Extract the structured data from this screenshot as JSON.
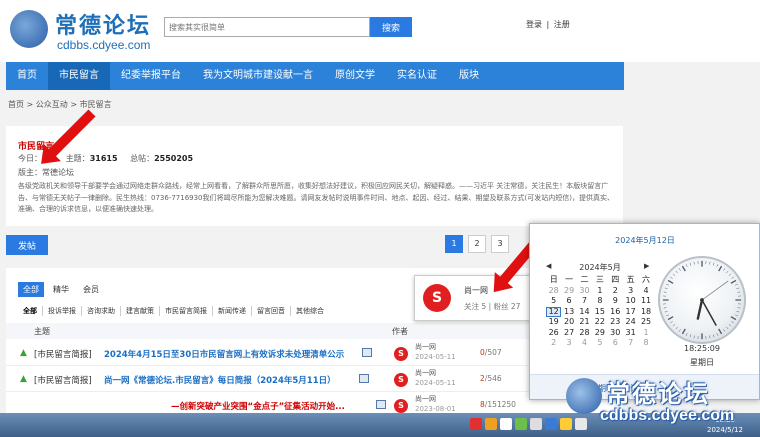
{
  "site": {
    "title": "常德论坛",
    "domain": "cdbbs.cdyee.com",
    "search_placeholder": "搜索其实很简单",
    "search_button": "搜索",
    "login": "登录",
    "register": "注册",
    "login_sep": "|"
  },
  "nav": {
    "items": [
      "首页",
      "市民留言",
      "纪委举报平台",
      "我为文明城市建设献一言",
      "原创文学",
      "实名认证",
      "版块"
    ],
    "active_index": 1
  },
  "breadcrumb": [
    "首页",
    "公众互动",
    "市民留言"
  ],
  "forum": {
    "title": "市民留言",
    "today_label": "今日：",
    "today_value": "41",
    "topics_label": "主题：",
    "topics_value": "31615",
    "posts_label": "总帖：",
    "posts_value": "2550205",
    "moderator_label": "版主：",
    "moderator_value": "常德论坛",
    "description": "各级党政机关和领导干部要学会通过网络走群众路线，经常上网看看，了解群众所思所愿，收集好想法好建议，积极回应网民关切，解疑释惑。——习近平 关注常德，关注民生！本版块留言广告、与常德无关帖子一律删除。民生热线：0736-7716930我们将竭尽所能为您解决难题。请网友发帖时说明事件时间、地点、起因、经过、结果、期望及联系方式(可发站内短信)，提供真实、准确、合理的诉求信息，以便准确快速处理。"
  },
  "post_button": "发帖",
  "pager": [
    "1",
    "2",
    "3"
  ],
  "pager_active": 0,
  "filters": [
    "全部",
    "精华",
    "会员"
  ],
  "filters_active": 0,
  "types": [
    "全部",
    "投诉举报",
    "咨询求助",
    "建言献策",
    "市民留言简报",
    "新闻传递",
    "留言回音",
    "其他综合"
  ],
  "types_active": 0,
  "columns": {
    "subject": "主题",
    "author": "作者"
  },
  "threads": [
    {
      "type": "[市民留言简报]",
      "title": "2024年4月15日至30日市民留言网上有效诉求未处理清单公示",
      "author": "尚一网",
      "date": "2024-05-11",
      "replies": "0",
      "views": "507"
    },
    {
      "type": "[市民留言简报]",
      "title": "尚一网《常德论坛.市民留言》每日简报（2024年5月11日）",
      "author": "尚一网",
      "date": "2024-05-11",
      "replies": "2",
      "views": "546"
    },
    {
      "type": "",
      "title": "—创新突破产业突围“金点子”征集活动开始...",
      "author": "尚一网",
      "date": "2023-08-01",
      "replies": "8",
      "views": "151250"
    }
  ],
  "profile_popup": {
    "name": "尚一网",
    "follow_label": "关注",
    "follow_value": "5",
    "fans_label": "粉丝",
    "fans_value": "27"
  },
  "calendar": {
    "date_link": "2024年5月12日",
    "month_label": "2024年5月",
    "weekdays": [
      "日",
      "一",
      "二",
      "三",
      "四",
      "五",
      "六"
    ],
    "weeks": [
      [
        "28",
        "29",
        "30",
        "1",
        "2",
        "3",
        "4"
      ],
      [
        "5",
        "6",
        "7",
        "8",
        "9",
        "10",
        "11"
      ],
      [
        "12",
        "13",
        "14",
        "15",
        "16",
        "17",
        "18"
      ],
      [
        "19",
        "20",
        "21",
        "22",
        "23",
        "24",
        "25"
      ],
      [
        "26",
        "27",
        "28",
        "29",
        "30",
        "31",
        "1"
      ],
      [
        "2",
        "3",
        "4",
        "5",
        "6",
        "7",
        "8"
      ]
    ],
    "today": "12",
    "time": "18:25:09",
    "weekday": "星期日",
    "change_link": "更改日期和时间设置..."
  },
  "taskbar": {
    "time": "18:25",
    "date": "2024/5/12"
  },
  "colors": {
    "accent": "#2a7ae2",
    "nav": "#2c82d9",
    "highlight_red": "#e01010"
  }
}
